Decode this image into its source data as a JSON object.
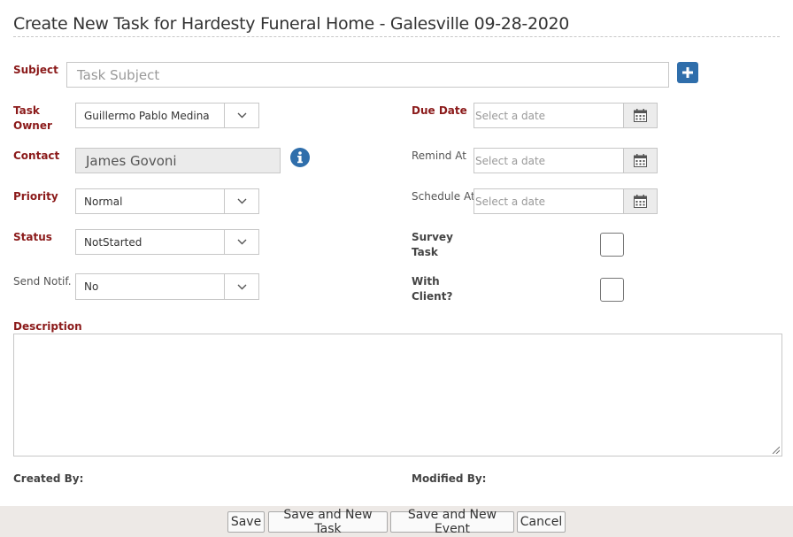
{
  "form": {
    "title": "Create New Task for Hardesty Funeral Home - Galesville 09-28-2020",
    "subject": {
      "label": "Subject",
      "placeholder": "Task Subject",
      "value": ""
    },
    "task_owner": {
      "label_line1": "Task",
      "label_line2": "Owner",
      "value": "Guillermo Pablo Medina"
    },
    "contact": {
      "label": "Contact",
      "value": "James Govoni"
    },
    "priority": {
      "label": "Priority",
      "value": "Normal"
    },
    "status": {
      "label": "Status",
      "value": "NotStarted"
    },
    "send_notif": {
      "label": "Send Notif.",
      "value": "No"
    },
    "due_date": {
      "label": "Due Date",
      "placeholder": "Select a date"
    },
    "remind_at": {
      "label": "Remind At",
      "placeholder": "Select a date"
    },
    "schedule_at": {
      "label": "Schedule At",
      "placeholder": "Select a date"
    },
    "survey_task": {
      "label_line1": "Survey",
      "label_line2": "Task",
      "checked": false
    },
    "with_client": {
      "label_line1": "With",
      "label_line2": "Client?",
      "checked": false
    },
    "description": {
      "label": "Description",
      "value": ""
    },
    "created_by": {
      "label": "Created By:"
    },
    "modified_by": {
      "label": "Modified By:"
    }
  },
  "buttons": {
    "save": "Save",
    "save_new_task": "Save and New Task",
    "save_new_event": "Save and New Event",
    "cancel": "Cancel"
  },
  "icons": {
    "add": "plus-icon",
    "info": "info-icon",
    "dropdown": "chevron-down-icon",
    "calendar": "calendar-icon"
  },
  "colors": {
    "required_label": "#8b1a1a",
    "accent_blue": "#2f6eab",
    "footer_bg": "#ede9e6"
  }
}
